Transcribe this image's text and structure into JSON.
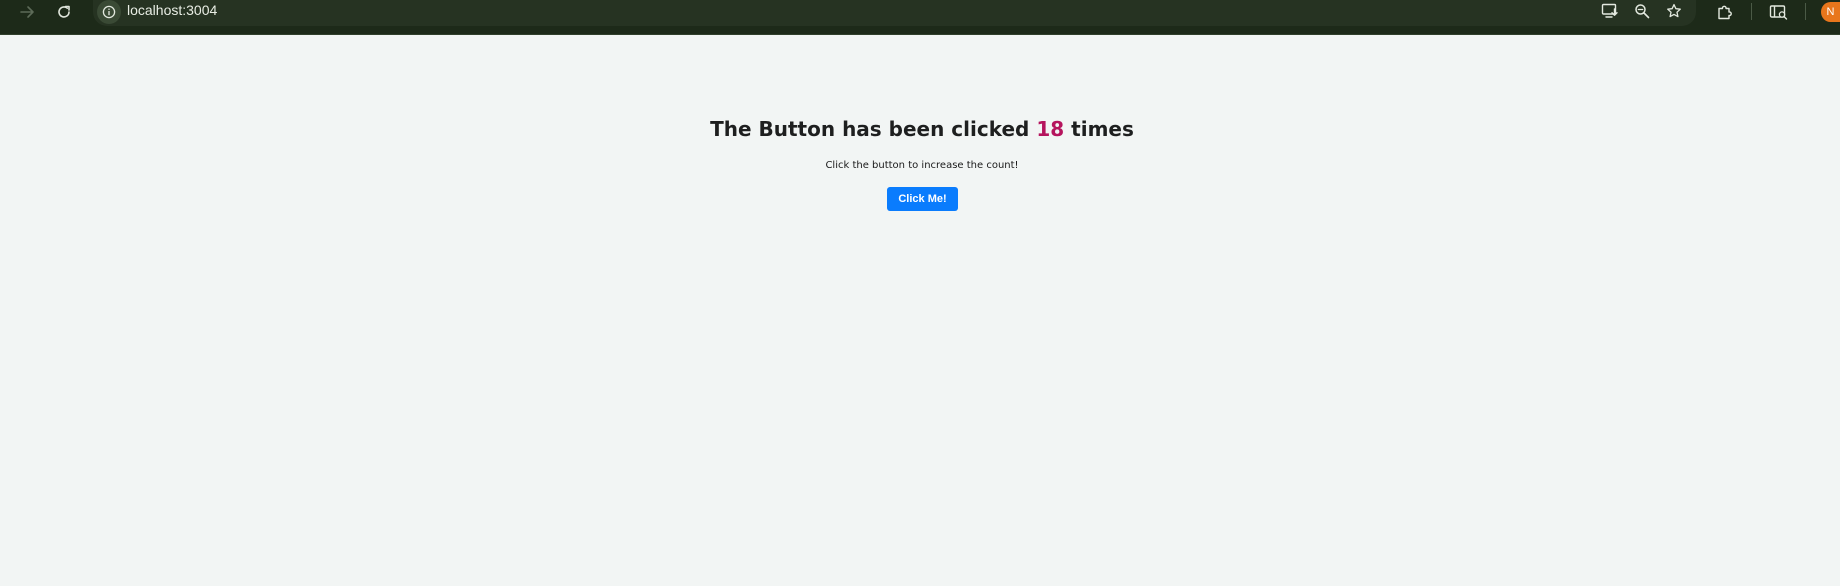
{
  "browser": {
    "url": "localhost:3004",
    "profile_initial": "N",
    "icons": {
      "back": "back-arrow-icon",
      "reload": "reload-icon",
      "site_info": "info-icon",
      "install": "install-app-icon",
      "zoom": "zoom-icon",
      "bookmark": "star-icon",
      "extensions": "puzzle-icon",
      "sidebar": "reading-mode-icon"
    }
  },
  "page": {
    "heading_prefix": "The Button has been clicked ",
    "click_count": "18",
    "heading_suffix": " times",
    "subtitle": "Click the button to increase the count!",
    "button_label": "Click Me!"
  },
  "colors": {
    "chrome_background": "#1d2a19",
    "page_background": "#f2f5f4",
    "count_accent": "#b5145d",
    "button_background": "#0a7cfd",
    "button_text": "#ffffff"
  }
}
